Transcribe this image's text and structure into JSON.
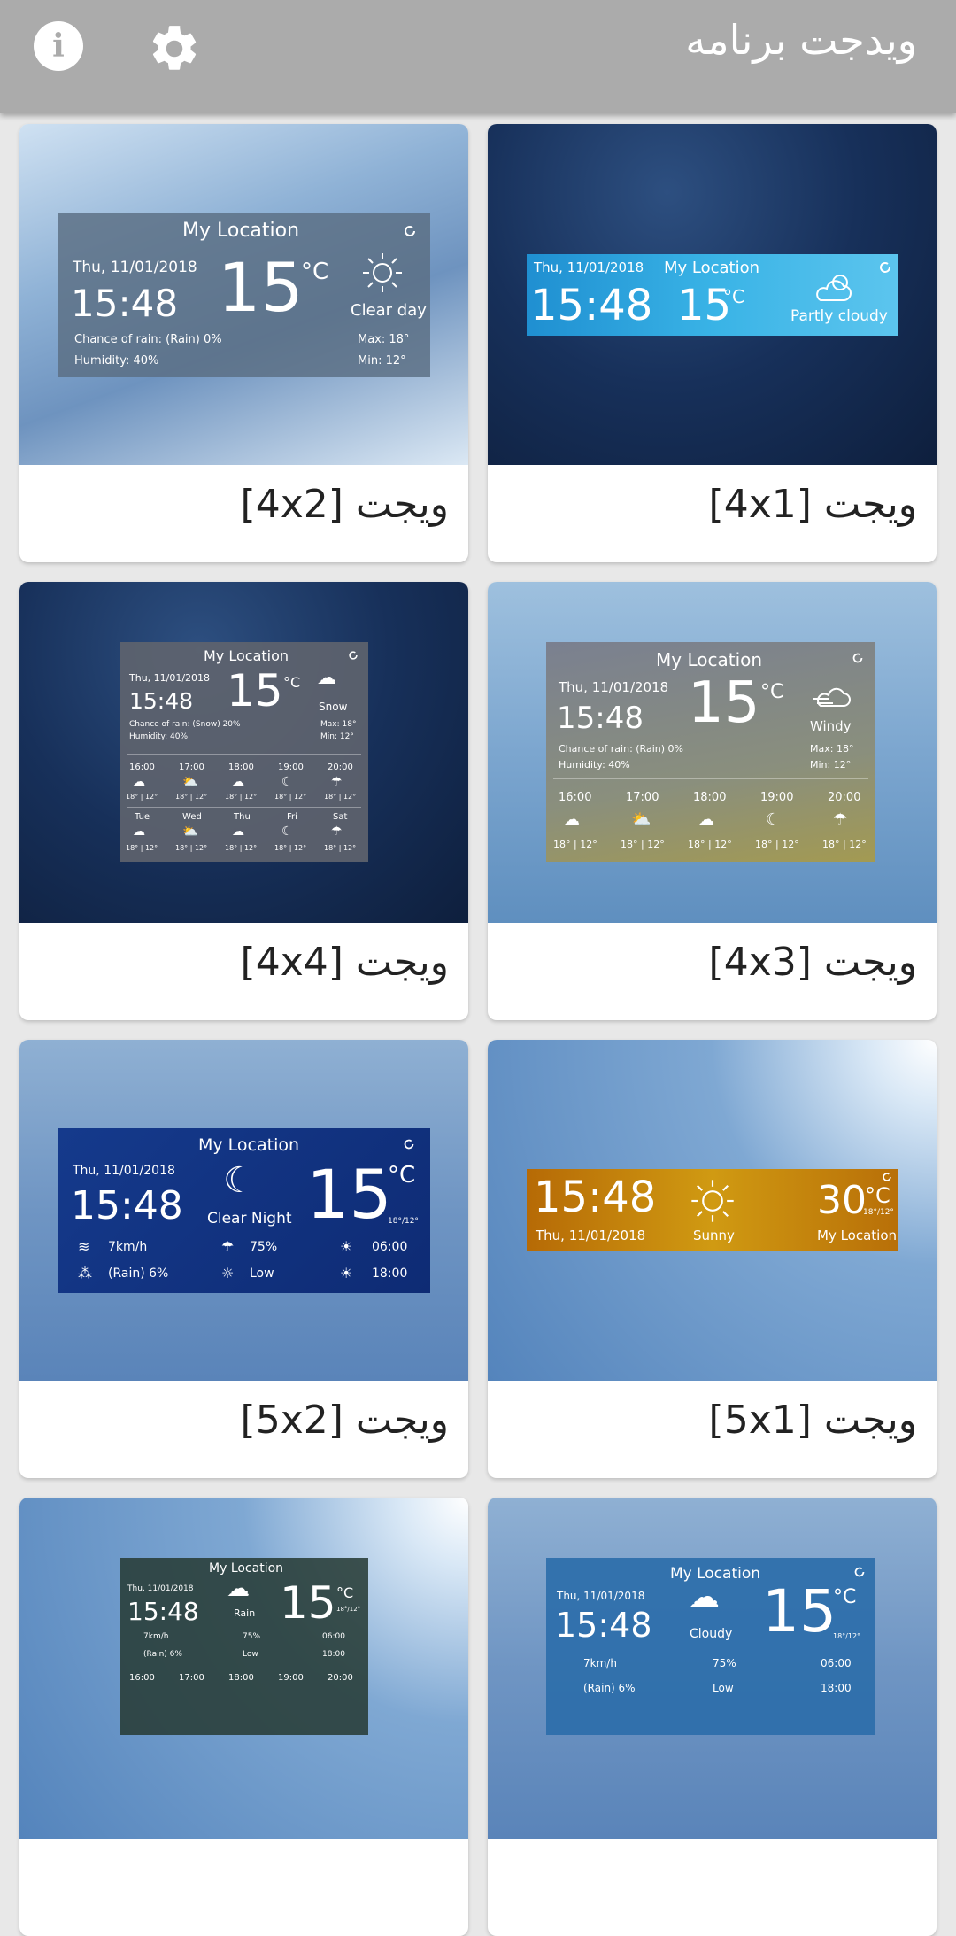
{
  "app": {
    "title": "ویدجت برنامه"
  },
  "common": {
    "location": "My Location",
    "date": "Thu, 11/01/2018",
    "time": "15:48",
    "temp": "15",
    "unit": "°C",
    "max": "Max: 18°",
    "min": "Min: 12°",
    "rain_chance": "Chance of rain: (Rain) 0%",
    "humidity": "Humidity: 40%",
    "hours": [
      "16:00",
      "17:00",
      "18:00",
      "19:00",
      "20:00"
    ],
    "hour_temps": "18° | 12°",
    "days": [
      "Tue",
      "Wed",
      "Thu",
      "Fri",
      "Sat"
    ],
    "small_temp": "18°/12°",
    "wind": "7km/h",
    "rain": "(Rain) 6%",
    "humidity_pct": "75%",
    "uv": "Low",
    "sunrise": "06:00",
    "sunset": "18:00"
  },
  "cards": [
    {
      "label": "ویجت [4x1]",
      "condition": "Partly cloudy"
    },
    {
      "label": "ویجت [4x2]",
      "condition": "Clear day"
    },
    {
      "label": "ویجت [4x3]",
      "condition": "Windy"
    },
    {
      "label": "ویجت [4x4]",
      "condition": "Snow",
      "rain_chance": "Chance of rain: (Snow) 20%"
    },
    {
      "label": "ویجت [5x1]",
      "condition": "Sunny",
      "temp": "30"
    },
    {
      "label": "ویجت [5x2]",
      "condition": "Clear Night"
    },
    {
      "condition": "Rain"
    },
    {
      "condition": "Cloudy"
    }
  ],
  "colors": {
    "appbar": "#ababab",
    "card": "#ffffff",
    "background": "#e8e8e8"
  }
}
